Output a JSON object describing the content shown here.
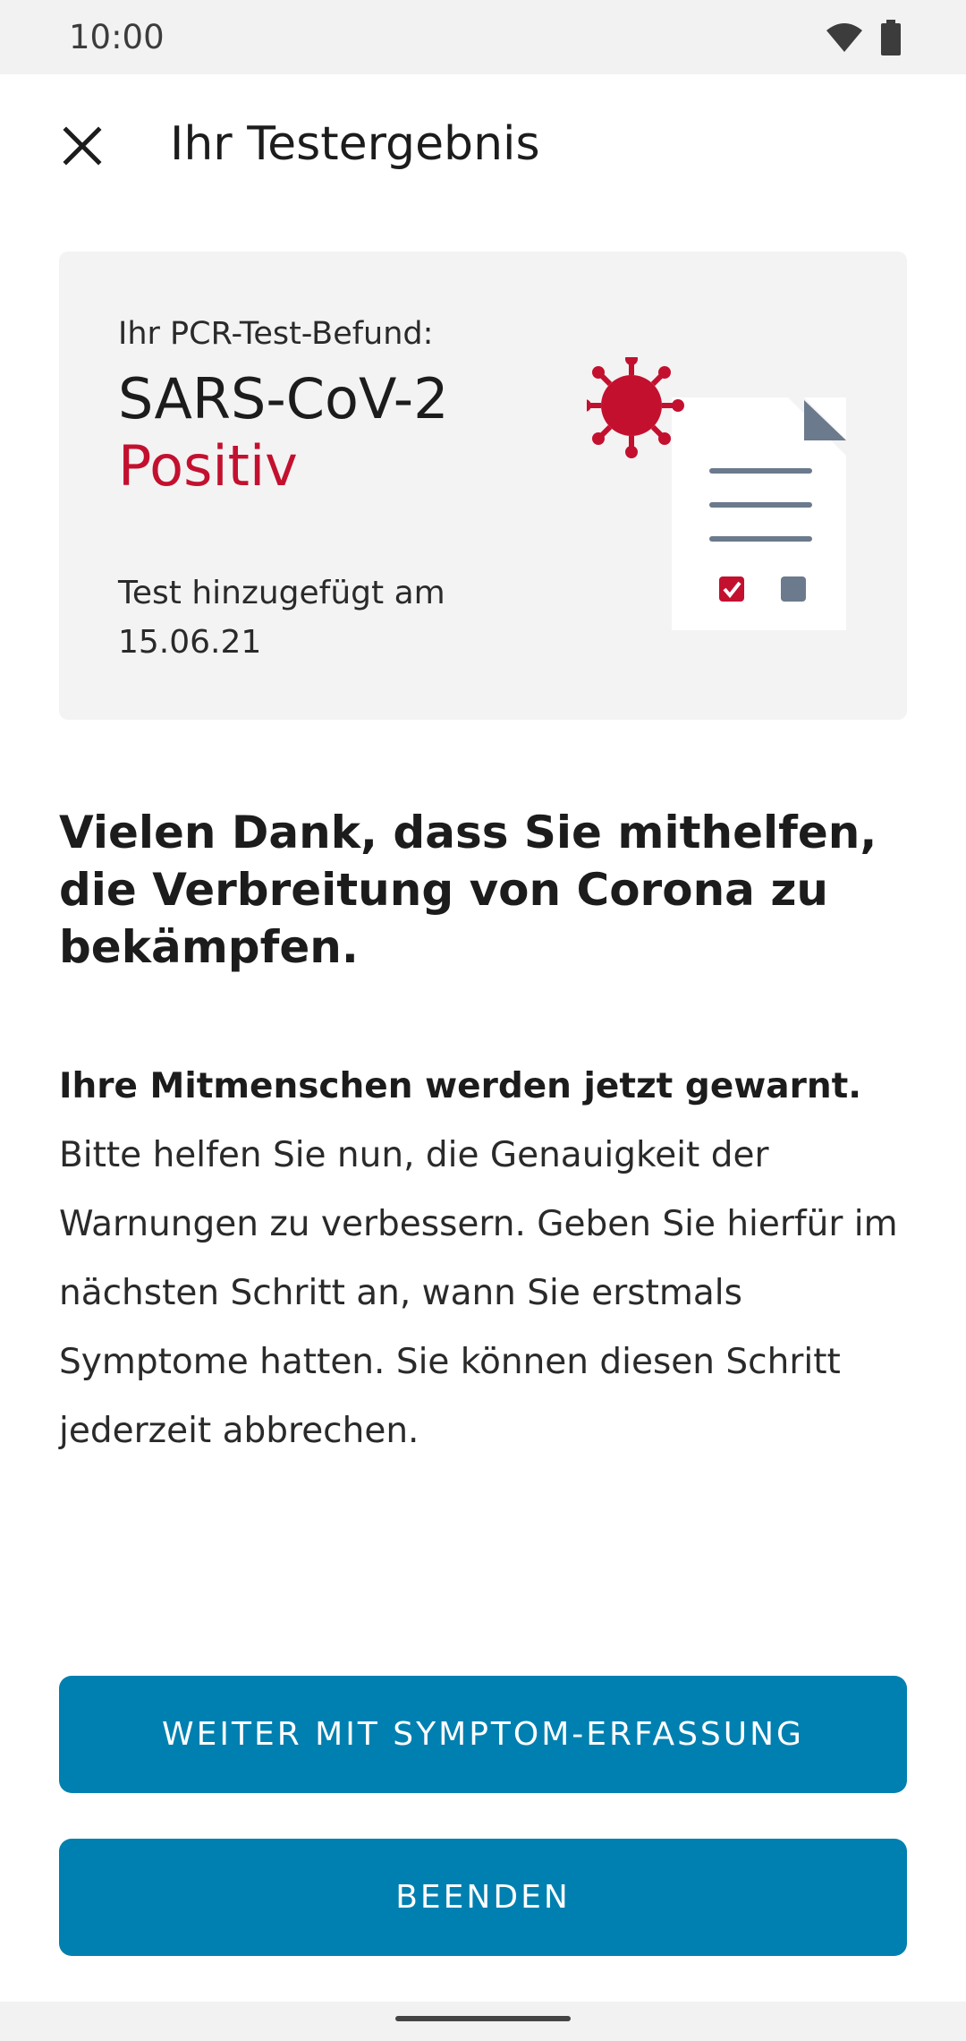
{
  "status_bar": {
    "time": "10:00",
    "icons": [
      "wifi-icon",
      "battery-icon"
    ]
  },
  "app_bar": {
    "title": "Ihr Testergebnis",
    "close_icon": "close-icon"
  },
  "result_card": {
    "label": "Ihr PCR-Test-Befund:",
    "virus": "SARS-CoV-2",
    "result": "Positiv",
    "date_label": "Test hinzugefügt am",
    "date_value": "15.06.21",
    "illustration_icon": "test-document-virus-icon"
  },
  "headline": "Vielen Dank, dass Sie mithelfen, die Verbreitung von Corona zu bekämpfen.",
  "body": {
    "bold": "Ihre Mitmenschen werden jetzt gewarnt.",
    "text": " Bitte helfen Sie nun, die Genauigkeit der Warnungen zu verbessern. Geben Sie hierfür im nächsten Schritt an, wann Sie erstmals Symptome hatten. Sie können diesen Schritt jederzeit abbrechen."
  },
  "buttons": {
    "symptom": "WEITER MIT SYMPTOM-ERFASSUNG",
    "finish": "BEENDEN"
  },
  "colors": {
    "accent": "#0080b0",
    "positive": "#c3102f",
    "card_bg": "#f3f3f3"
  }
}
